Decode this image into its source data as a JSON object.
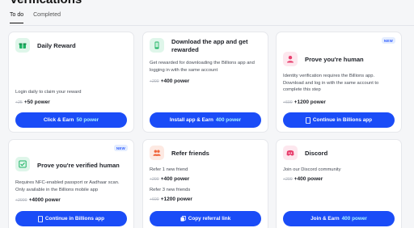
{
  "page": {
    "title": "Verifications"
  },
  "tabs": [
    "To do",
    "Completed"
  ],
  "cards": {
    "daily": {
      "title": "Daily Reward",
      "desc": "Login daily to claim your reward",
      "old": "+25",
      "new": "+50 power",
      "button": "Click & Earn",
      "button_accent": "50 power",
      "icon": "gift-icon",
      "icon_bg": "#dff6ea"
    },
    "app": {
      "title": "Download the app and get rewarded",
      "desc": "Get rewarded for downloading the Billions app and logging in with the same account",
      "old": "+200",
      "new": "+400 power",
      "button": "Install app & Earn",
      "button_accent": "400 power",
      "icon": "phone-icon",
      "icon_bg": "#dff6ea"
    },
    "human": {
      "title": "Prove you're human",
      "badge": "NEW",
      "desc": "Identity verification requires the Billions app. Download and log in with the same account to complete this step",
      "old": "+600",
      "new": "+1200 power",
      "button": "Continue in Billions app",
      "icon": "person-icon",
      "icon_bg": "#fde7ee"
    },
    "verified": {
      "title": "Prove you're verified human",
      "badge": "NEW",
      "desc": "Requires NFC-enabled passport or Aadhaar scan. Only available in the Billions mobile app",
      "old": "+2000",
      "new": "+4000 power",
      "button": "Continue in Billions app",
      "icon": "id-check-icon",
      "icon_bg": "#dff6ea"
    },
    "refer": {
      "title": "Refer friends",
      "line1": "Refer 1 new friend",
      "old1": "+200",
      "new1": "+400 power",
      "line2": "Refer 3 new friends",
      "old2": "+600",
      "new2": "+1200 power",
      "button": "Copy referral link",
      "icon": "people-icon",
      "icon_bg": "#fde9e2"
    },
    "discord": {
      "title": "Discord",
      "desc": "Join our Discord community",
      "old": "+200",
      "new": "+400 power",
      "button": "Join & Earn",
      "button_accent": "400 power",
      "icon": "discord-icon",
      "icon_bg": "#fde7ee"
    }
  },
  "colors": {
    "primary": "#1a4cf7",
    "accent": "#a6f2ff",
    "badge_bg": "#e4edff",
    "badge_text": "#2d5bff"
  }
}
